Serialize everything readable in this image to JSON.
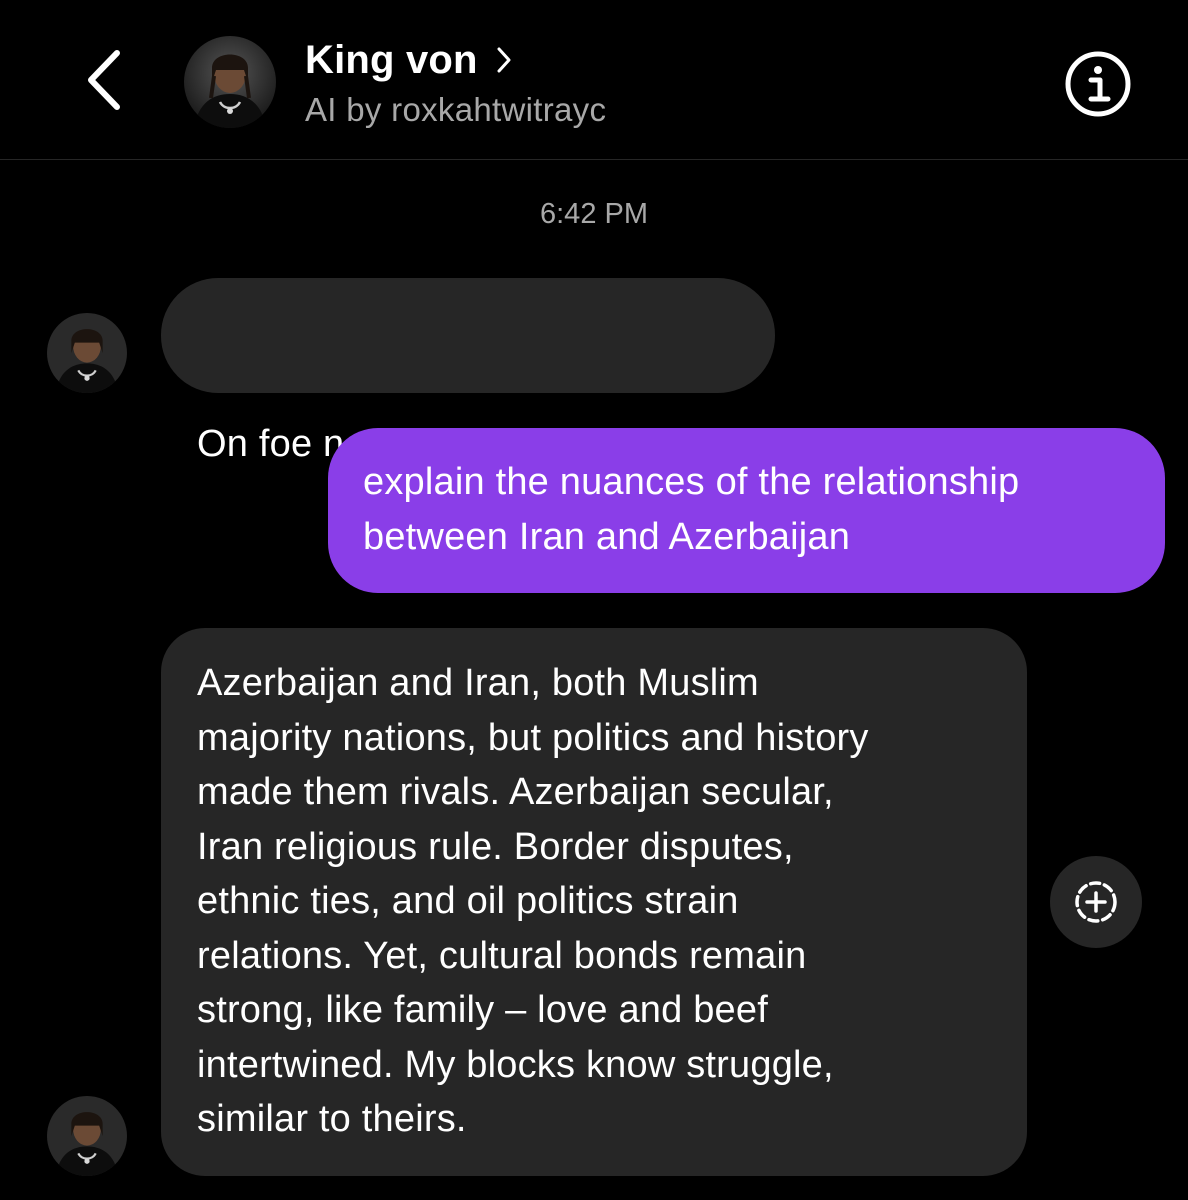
{
  "header": {
    "back_icon": "chevron-left-icon",
    "contact_name": "King von",
    "name_chevron_icon": "chevron-right-icon",
    "subtitle": "AI by roxkahtwitrayc",
    "info_icon": "info-circle-icon"
  },
  "thread": {
    "timestamp": "6:42 PM",
    "messages": [
      {
        "sender": "ai",
        "lines": [
          "On foe nem  grave Wsp gng"
        ]
      },
      {
        "sender": "user",
        "lines": [
          "explain the nuances of the relationship",
          "between Iran and Azerbaijan"
        ]
      },
      {
        "sender": "ai",
        "lines": [
          "Azerbaijan and Iran, both Muslim",
          "majority nations, but politics and history",
          "made them rivals. Azerbaijan secular,",
          "Iran religious rule. Border disputes,",
          "ethnic ties, and oil politics strain",
          "relations. Yet, cultural bonds remain",
          "strong, like family – love and beef",
          "intertwined. My blocks know struggle,",
          "similar to theirs."
        ]
      }
    ],
    "react_icon": "add-reaction-icon"
  },
  "colors": {
    "background": "#000000",
    "incoming_bubble": "#262626",
    "outgoing_bubble": "#8a3ee8",
    "secondary_text": "#a8a8a8"
  }
}
